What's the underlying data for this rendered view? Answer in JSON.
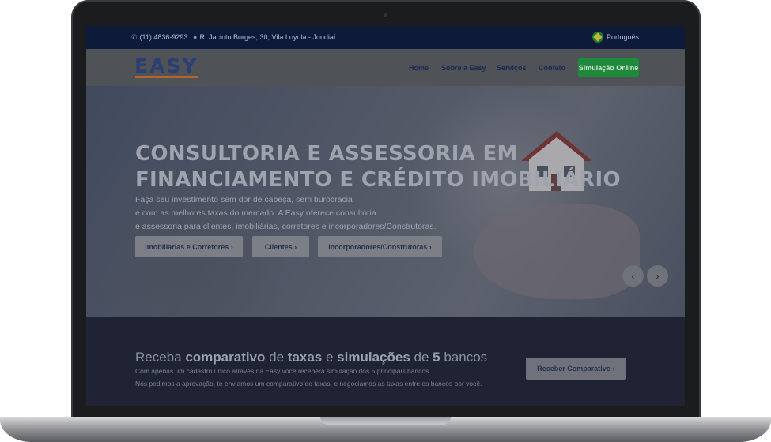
{
  "topbar": {
    "phone": "(11) 4836-9293",
    "address": "R. Jacinto Borges, 30, Vila Loyola - Jundiaí",
    "language": "Português"
  },
  "nav": {
    "logo_text": "EASY",
    "items": [
      "Home",
      "Sobre a Easy",
      "Serviços",
      "Contato"
    ],
    "cta": "Simulação Online"
  },
  "hero": {
    "title_line1": "CONSULTORIA E ASSESSORIA EM",
    "title_line2": "FINANCIAMENTO E CRÉDITO IMOBILIÁRIO",
    "sub_line1": "Faça seu investimento sem dor de cabeça, sem burocracia",
    "sub_line2": "e com as melhores taxas do mercado. A Easy oferece consultoria",
    "sub_line3": "e assessoria para clientes, imobiliárias, corretores e incorporadores/Construtoras.",
    "buttons": [
      "Imobiliarias e Corretores",
      "Clientes",
      "Incorporadores/Construtoras"
    ],
    "prev": "‹",
    "next": "›"
  },
  "compare": {
    "t1": "Receba ",
    "t2": "comparativo",
    "t3": " de ",
    "t4": "taxas",
    "t5": " e ",
    "t6": "simulações",
    "t7": " de ",
    "t8": "5",
    "t9": " bancos",
    "line1": "Com apenas um cadastro único através da Easy você receberá simulação dos 5 principais bancos.",
    "line2": "Nós pedimos a aprovação, te enviamos um comparativo de taxas, e negociamos as taxas entre os bancos por você.",
    "button": "Receber Comparativo"
  },
  "colors": {
    "topbar": "#0e1a3a",
    "cta_green": "#1f8a3a",
    "logo_blue": "#2b3f73",
    "logo_orange": "#b4672d"
  }
}
